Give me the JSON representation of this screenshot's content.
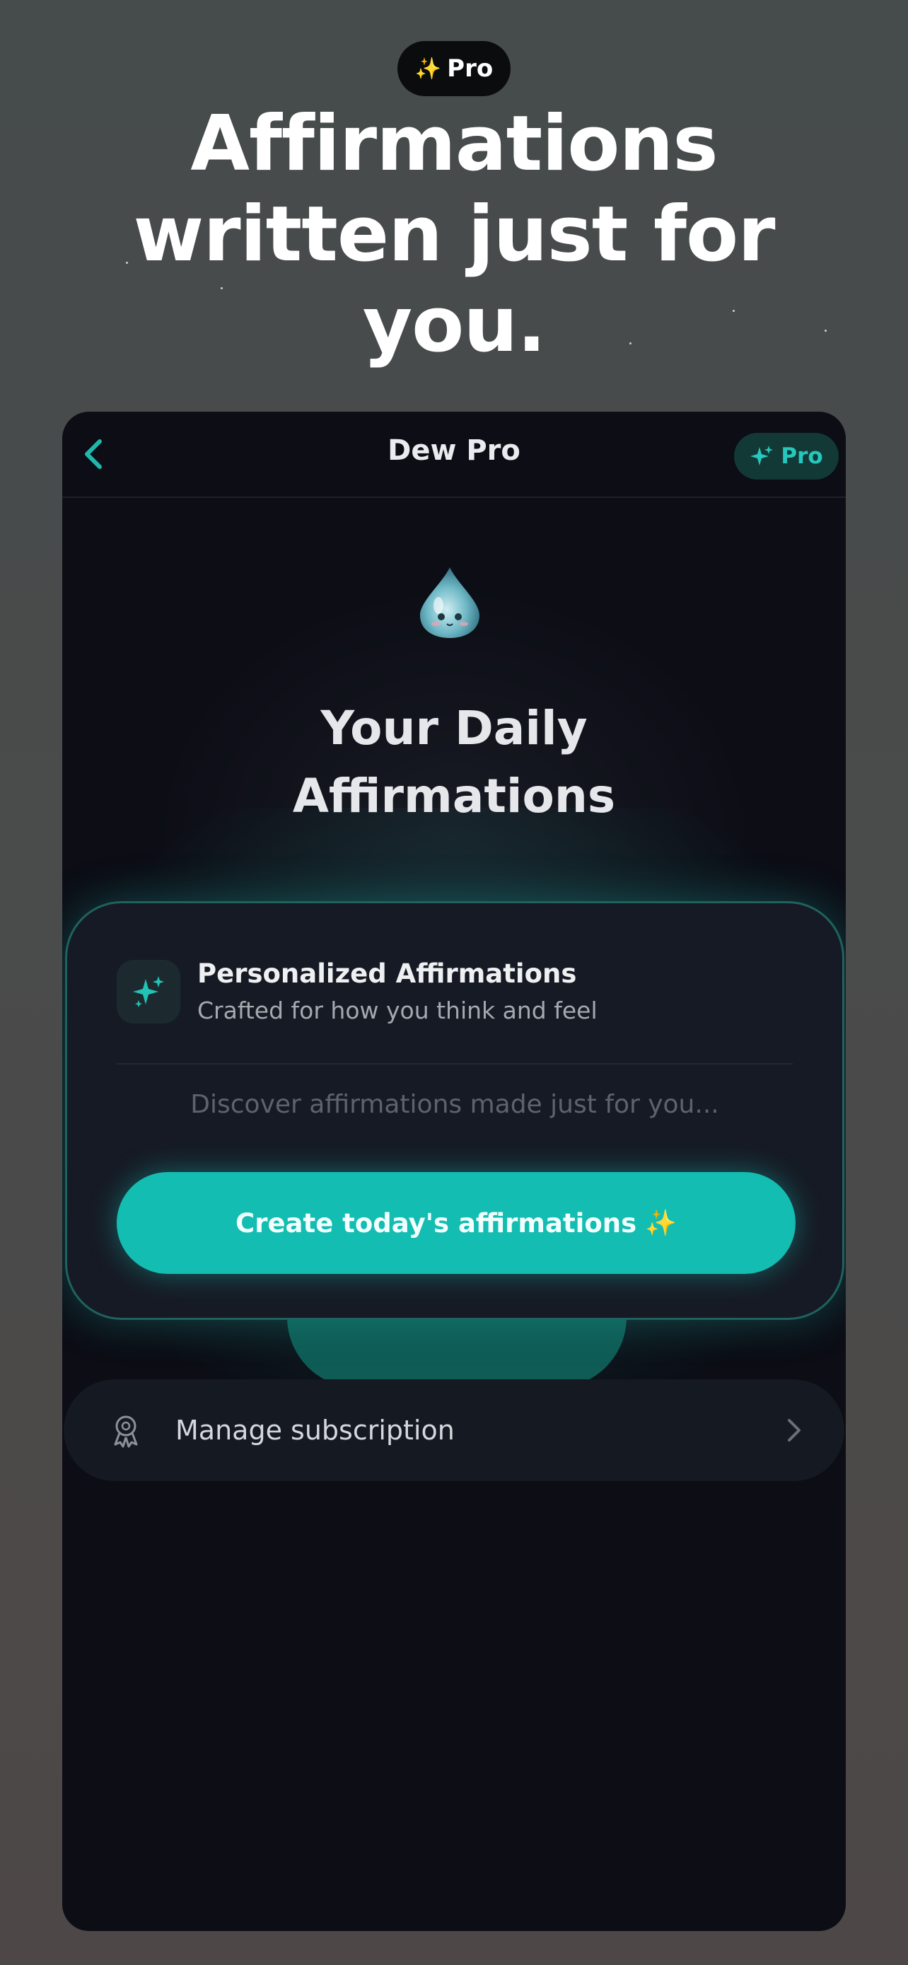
{
  "promo": {
    "badge_icon": "sparkles-icon",
    "badge_label": "Pro",
    "headline_lines": [
      "Affirmations",
      "written just for",
      "you."
    ]
  },
  "app": {
    "nav": {
      "back_icon": "chevron-left-icon",
      "title": "Dew Pro",
      "pro_chip_icon": "sparkles-icon",
      "pro_chip_label": "Pro"
    },
    "mascot": "water-drop-mascot",
    "screen_title_lines": [
      "Your Daily",
      "Affirmations"
    ],
    "card": {
      "icon": "sparkles-icon",
      "title": "Personalized Affirmations",
      "subtitle": "Crafted for how you think and feel",
      "placeholder": "Discover affirmations made just for you...",
      "cta_label": "Create today's affirmations",
      "cta_emoji": "✨"
    },
    "manage": {
      "icon": "award-ribbon-icon",
      "label": "Manage subscription",
      "chevron_icon": "chevron-right-icon"
    }
  },
  "colors": {
    "accent": "#13bdb2",
    "accent_text": "#26c7bc",
    "phone_bg": "#0c0d15",
    "card_bg": "#161a24",
    "sparkle_gold": "#f4c64a"
  }
}
